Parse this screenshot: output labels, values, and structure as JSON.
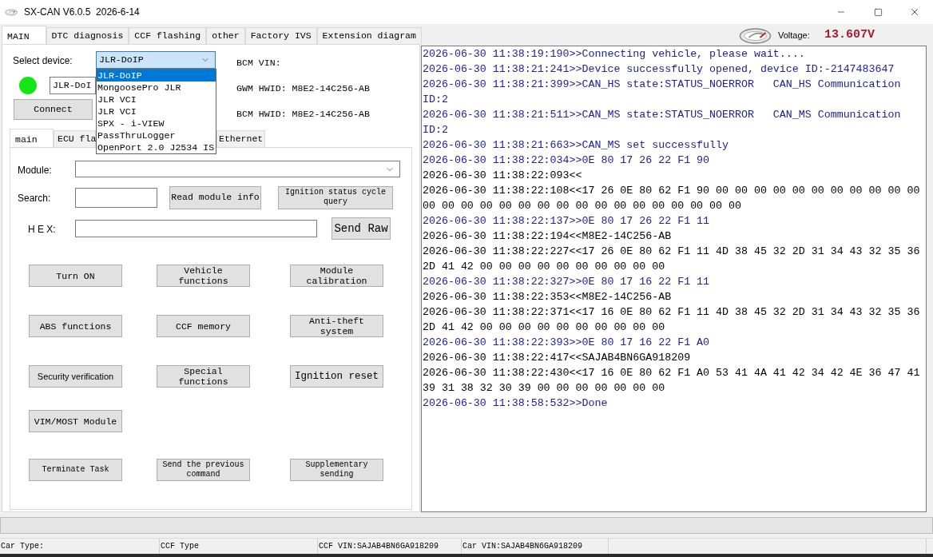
{
  "window": {
    "title": "SX-CAN V6.0.5  2026-6-14"
  },
  "tabs": [
    {
      "label": "MAIN",
      "selected": true
    },
    {
      "label": "DTC diagnosis",
      "selected": false
    },
    {
      "label": "CCF flashing",
      "selected": false
    },
    {
      "label": "other",
      "selected": false
    },
    {
      "label": "Factory IVS",
      "selected": false
    },
    {
      "label": "Extension diagram",
      "selected": false
    }
  ],
  "voltage": {
    "label": "Voltage:",
    "value": "13.607V"
  },
  "device": {
    "label": "Select device:",
    "value": "JLR-DoIP",
    "expanded": true,
    "options": [
      {
        "label": "JLR-DoIP",
        "selected": true
      },
      {
        "label": "MongoosePro JLR",
        "selected": false
      },
      {
        "label": "JLR VCI",
        "selected": false
      },
      {
        "label": "JLR VCI",
        "selected": false
      },
      {
        "label": "SPX - i-VIEW",
        "selected": false
      },
      {
        "label": "PassThruLogger",
        "selected": false
      },
      {
        "label": "OpenPort 2.0 J2534 IS",
        "selected": false
      }
    ],
    "connected": true,
    "name_field": "JLR-DoI",
    "connect_button": "Connect"
  },
  "vehicle_info": [
    "BCM VIN:",
    "GWM HWID: M8E2-14C256-AB",
    "BCM HWID: M8E2-14C256-AB"
  ],
  "sub_tabs": [
    {
      "label": "main",
      "selected": true
    },
    {
      "label": "ECU fla",
      "selected": false
    },
    {
      "label": "Ethernet",
      "selected": false
    }
  ],
  "module_select": {
    "label": "Module:"
  },
  "search": {
    "label": "Search:",
    "buttons": [
      "Read module info",
      "Ignition status cycle query"
    ]
  },
  "hex": {
    "label": "H E X:",
    "button": "Send Raw"
  },
  "function_buttons": [
    [
      {
        "label": "Turn ON",
        "kind": "standard"
      },
      {
        "label": "Vehicle functions",
        "kind": "standard"
      },
      {
        "label": "Module calibration",
        "kind": "standard"
      }
    ],
    [
      {
        "label": "ABS functions",
        "kind": "standard"
      },
      {
        "label": "CCF memory",
        "kind": "standard"
      },
      {
        "label": "Anti-theft system",
        "kind": "standard"
      }
    ],
    [
      {
        "label": "Security verification",
        "kind": "sans"
      },
      {
        "label": "Special functions",
        "kind": "standard"
      },
      {
        "label": "Ignition reset",
        "kind": "large"
      }
    ],
    [
      {
        "label": "VIM/MOST Module",
        "kind": "standard"
      }
    ],
    [
      {
        "label": "Terminate Task",
        "kind": "small"
      },
      {
        "label": "Send the previous command",
        "kind": "small"
      },
      {
        "label": "Supplementary sending",
        "kind": "small"
      }
    ]
  ],
  "log": [
    {
      "kind": "out",
      "text": "2026-06-30 11:38:19:190>>Connecting vehicle, please wait...."
    },
    {
      "kind": "out",
      "text": "2026-06-30 11:38:21:241>>Device successfully opened, device ID:-2147483647"
    },
    {
      "kind": "out",
      "text": "2026-06-30 11:38:21:399>>CAN_HS state:STATUS_NOERROR   CAN_HS Communication ID:2"
    },
    {
      "kind": "out",
      "text": "2026-06-30 11:38:21:511>>CAN_MS state:STATUS_NOERROR   CAN_MS Communication ID:2"
    },
    {
      "kind": "out",
      "text": "2026-06-30 11:38:21:663>>CAN_MS set successfully"
    },
    {
      "kind": "out",
      "text": "2026-06-30 11:38:22:034>>0E 80 17 26 22 F1 90"
    },
    {
      "kind": "in",
      "text": "2026-06-30 11:38:22:093<<"
    },
    {
      "kind": "in",
      "text": "2026-06-30 11:38:22:108<<17 26 0E 80 62 F1 90 00 00 00 00 00 00 00 00 00 00 00 00 00 00 00 00 00 00 00 00 00 00 00 00 00 00 00 00"
    },
    {
      "kind": "out",
      "text": "2026-06-30 11:38:22:137>>0E 80 17 26 22 F1 11"
    },
    {
      "kind": "in",
      "text": "2026-06-30 11:38:22:194<<M8E2-14C256-AB"
    },
    {
      "kind": "in",
      "text": "2026-06-30 11:38:22:227<<17 26 0E 80 62 F1 11 4D 38 45 32 2D 31 34 43 32 35 36 2D 41 42 00 00 00 00 00 00 00 00 00 00"
    },
    {
      "kind": "out",
      "text": "2026-06-30 11:38:22:327>>0E 80 17 16 22 F1 11"
    },
    {
      "kind": "in",
      "text": "2026-06-30 11:38:22:353<<M8E2-14C256-AB"
    },
    {
      "kind": "in",
      "text": "2026-06-30 11:38:22:371<<17 16 0E 80 62 F1 11 4D 38 45 32 2D 31 34 43 32 35 36 2D 41 42 00 00 00 00 00 00 00 00 00 00"
    },
    {
      "kind": "out",
      "text": "2026-06-30 11:38:22:393>>0E 80 17 16 22 F1 A0"
    },
    {
      "kind": "in",
      "text": "2026-06-30 11:38:22:417<<SAJAB4BN6GA918209"
    },
    {
      "kind": "in",
      "text": "2026-06-30 11:38:22:430<<17 16 0E 80 62 F1 A0 53 41 4A 41 42 34 42 4E 36 47 41 39 31 38 32 30 39 00 00 00 00 00 00 00"
    },
    {
      "kind": "out",
      "text": "2026-06-30 11:38:58:532>>Done"
    }
  ],
  "status_bar": [
    "Car Type:",
    "CCF Type",
    "CCF VIN:SAJAB4BN6GA918209",
    "Car VIN:SAJAB4BN6GA918209"
  ]
}
